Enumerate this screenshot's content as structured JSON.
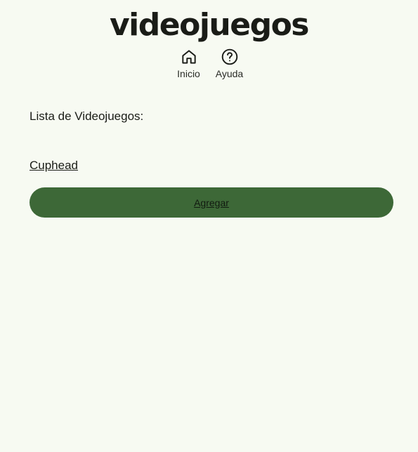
{
  "header": {
    "title": "videojuegos",
    "nav": [
      {
        "label": "Inicio",
        "icon": "home-icon"
      },
      {
        "label": "Ayuda",
        "icon": "help-circle-icon"
      }
    ]
  },
  "main": {
    "list_title": "Lista de Videojuegos:",
    "games": [
      "Cuphead"
    ],
    "add_button_label": "Agregar"
  },
  "colors": {
    "background": "#f7faf2",
    "primary": "#3d6837",
    "text": "#1a1c17"
  }
}
